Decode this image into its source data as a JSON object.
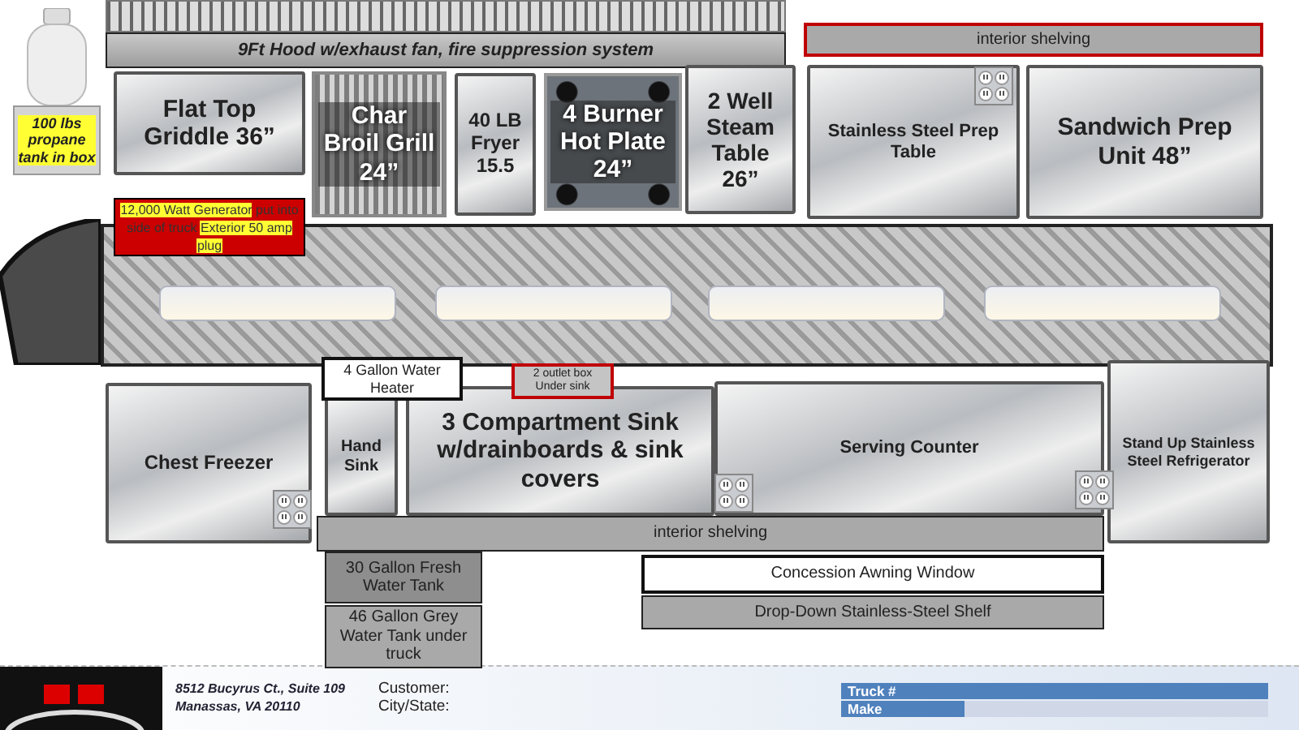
{
  "plan": {
    "blocks": [
      {
        "kind": "bar",
        "text": "9Ft Hood w/exhaust fan, fire suppression system"
      },
      {
        "kind": "note",
        "text": "100 lbs propane tank in box"
      },
      {
        "kind": "steel",
        "text": "Flat Top Griddle 36”"
      },
      {
        "kind": "grill",
        "text": "Char Broil Grill 24”"
      },
      {
        "kind": "steel",
        "text": "40 LB Fryer 15.5"
      },
      {
        "kind": "burner",
        "text": "4 Burner Hot Plate 24”"
      },
      {
        "kind": "steel",
        "text": "2 Well Steam Table 26”"
      },
      {
        "kind": "shelf",
        "text": "interior shelving"
      },
      {
        "kind": "steel",
        "text": "Stainless Steel Prep Table"
      },
      {
        "kind": "steel",
        "text": "Sandwich Prep Unit 48”"
      },
      {
        "kind": "alert",
        "segments": [
          {
            "text": "12,000 Watt Generator",
            "highlighted": true
          },
          {
            "text": " put into side of truck ",
            "highlighted": false
          },
          {
            "text": "Exterior 50 amp plug",
            "highlighted": true
          }
        ]
      },
      {
        "kind": "label",
        "text": "4 Gallon Water Heater"
      },
      {
        "kind": "small",
        "text": "2 outlet box Under sink"
      },
      {
        "kind": "steel",
        "text": "Chest Freezer"
      },
      {
        "kind": "steel",
        "text": "Hand Sink"
      },
      {
        "kind": "steel",
        "text": "3 Compartment Sink w/drainboards & sink covers"
      },
      {
        "kind": "steel",
        "text": "Serving Counter"
      },
      {
        "kind": "steel",
        "text": "Stand Up Stainless Steel Refrigerator"
      },
      {
        "kind": "bar",
        "text": "interior shelving"
      },
      {
        "kind": "tank",
        "text": "30 Gallon Fresh Water Tank"
      },
      {
        "kind": "bar",
        "text": "46 Gallon Grey Water Tank under truck"
      },
      {
        "kind": "label",
        "text": "Concession Awning Window"
      },
      {
        "kind": "bar",
        "text": "Drop-Down Stainless-Steel Shelf"
      }
    ]
  },
  "footer": {
    "address": [
      "8512 Bucyrus Ct., Suite 109",
      "Manassas, VA 20110"
    ],
    "customer_labels": [
      "Customer:",
      "City/State:"
    ],
    "info_table": [
      {
        "label": "Truck #"
      },
      {
        "label": "Make"
      }
    ]
  }
}
